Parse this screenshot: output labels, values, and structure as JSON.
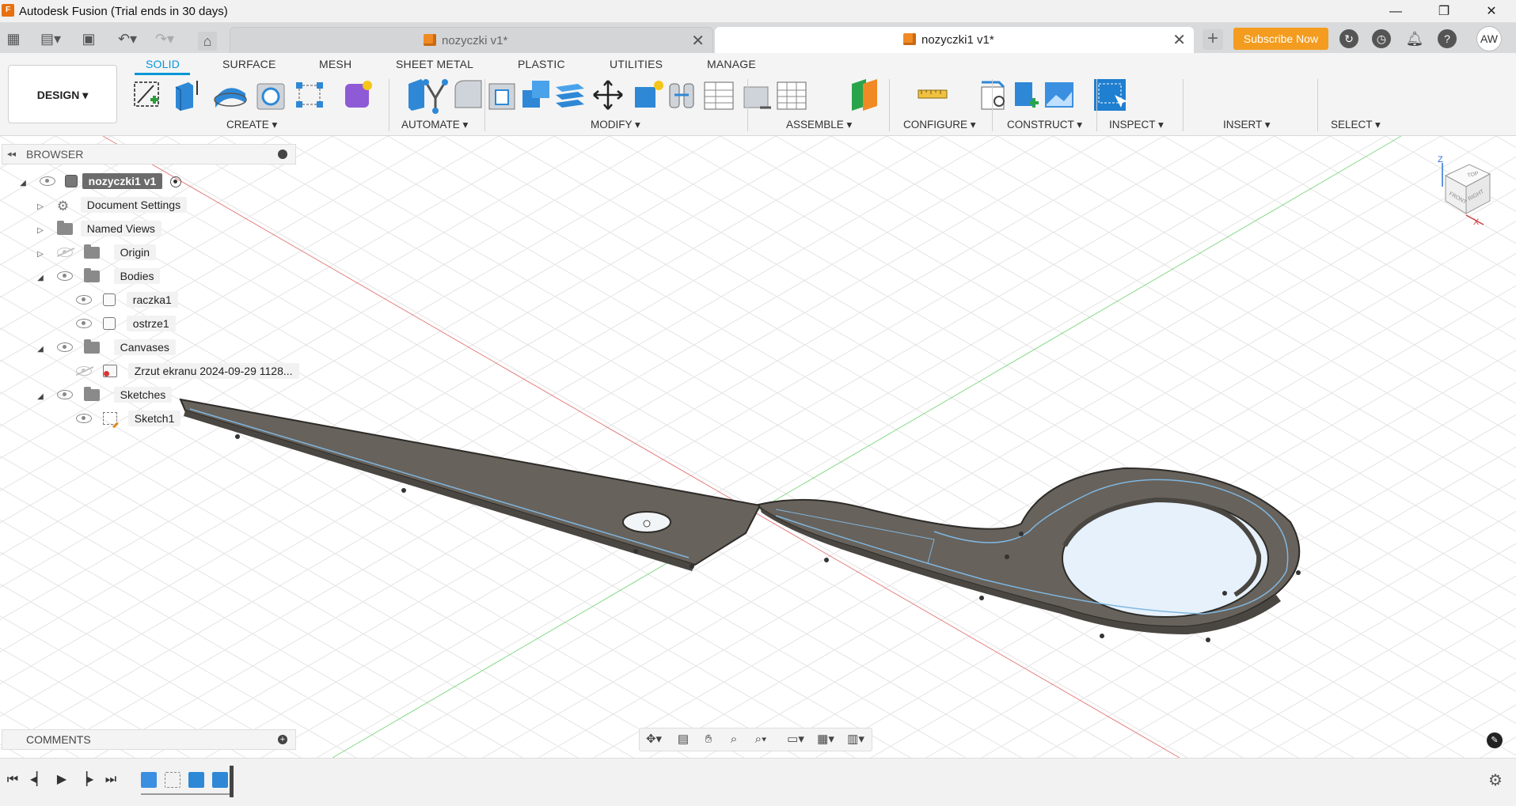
{
  "window": {
    "title": "Autodesk Fusion (Trial ends in 30 days)",
    "logo": "F",
    "min_glyph": "—",
    "max_glyph": "❐",
    "close_glyph": "✕"
  },
  "tabs": [
    {
      "label": "nozyczki v1*",
      "close": "✕"
    },
    {
      "label": "nozyczki1 v1*",
      "close": "✕"
    }
  ],
  "tabbar": {
    "add_glyph": "+",
    "subscribe_label": "Subscribe Now",
    "avatar_initials": "AW"
  },
  "toolbar": {
    "workspace_label": "DESIGN ▾",
    "tabs": [
      "SOLID",
      "SURFACE",
      "MESH",
      "SHEET METAL",
      "PLASTIC",
      "UTILITIES",
      "MANAGE"
    ],
    "groups": [
      "CREATE ▾",
      "AUTOMATE ▾",
      "MODIFY ▾",
      "ASSEMBLE ▾",
      "CONFIGURE ▾",
      "CONSTRUCT ▾",
      "INSPECT ▾",
      "INSERT ▾",
      "SELECT ▾"
    ],
    "accent": "#0696d7"
  },
  "browser": {
    "title": "BROWSER",
    "collapse_glyph": "◂◂",
    "items": [
      {
        "label": "nozyczki1 v1"
      },
      {
        "label": "Document Settings"
      },
      {
        "label": "Named Views"
      },
      {
        "label": "Origin"
      },
      {
        "label": "Bodies"
      },
      {
        "label": "raczka1"
      },
      {
        "label": "ostrze1"
      },
      {
        "label": "Canvases"
      },
      {
        "label": "Zrzut ekranu 2024-09-29 1128..."
      },
      {
        "label": "Sketches"
      },
      {
        "label": "Sketch1"
      }
    ]
  },
  "comments": {
    "title": "COMMENTS"
  },
  "viewcube": {
    "top": "TOP",
    "front": "FRONT",
    "right": "RIGHT",
    "z": "Z",
    "x": "X"
  },
  "colors": {
    "subscribe": "#f39c1f",
    "body": "#67625b",
    "sketch_line": "#7fb6e0"
  }
}
